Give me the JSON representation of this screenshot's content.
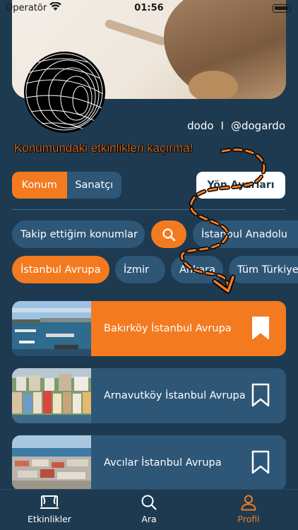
{
  "status_bar": {
    "carrier": "Operatör",
    "time": "01:56"
  },
  "profile": {
    "name": "dodo",
    "separator": "I",
    "handle": "@dogardo"
  },
  "promo_text": "Konumundaki etkinlikleri kaçırma!",
  "segment": {
    "options": [
      "Konum",
      "Sanatçı"
    ],
    "selected": "Konum"
  },
  "settings_button": "Yön Ayarları",
  "chips_row1": [
    "Takip ettiğim konumlar",
    "İstanbul Anadolu"
  ],
  "chips_row2": [
    "İstanbul Avrupa",
    "İzmir",
    "Ankara",
    "Tüm Türkiye"
  ],
  "locations": [
    {
      "title": "Bakırköy İstanbul Avrupa",
      "selected": true,
      "bookmarked": true
    },
    {
      "title": "Arnavutköy İstanbul Avrupa",
      "selected": false,
      "bookmarked": false
    },
    {
      "title": "Avcılar İstanbul Avrupa",
      "selected": false,
      "bookmarked": false
    }
  ],
  "tabs": [
    {
      "label": "Etkinlikler",
      "icon": "stage-icon",
      "active": false
    },
    {
      "label": "Ara",
      "icon": "search-icon",
      "active": false
    },
    {
      "label": "Profil",
      "icon": "user-icon",
      "active": true
    }
  ],
  "colors": {
    "background": "#1d3a50",
    "accent": "#f47a20",
    "chip": "#2e5677",
    "white": "#ffffff"
  }
}
